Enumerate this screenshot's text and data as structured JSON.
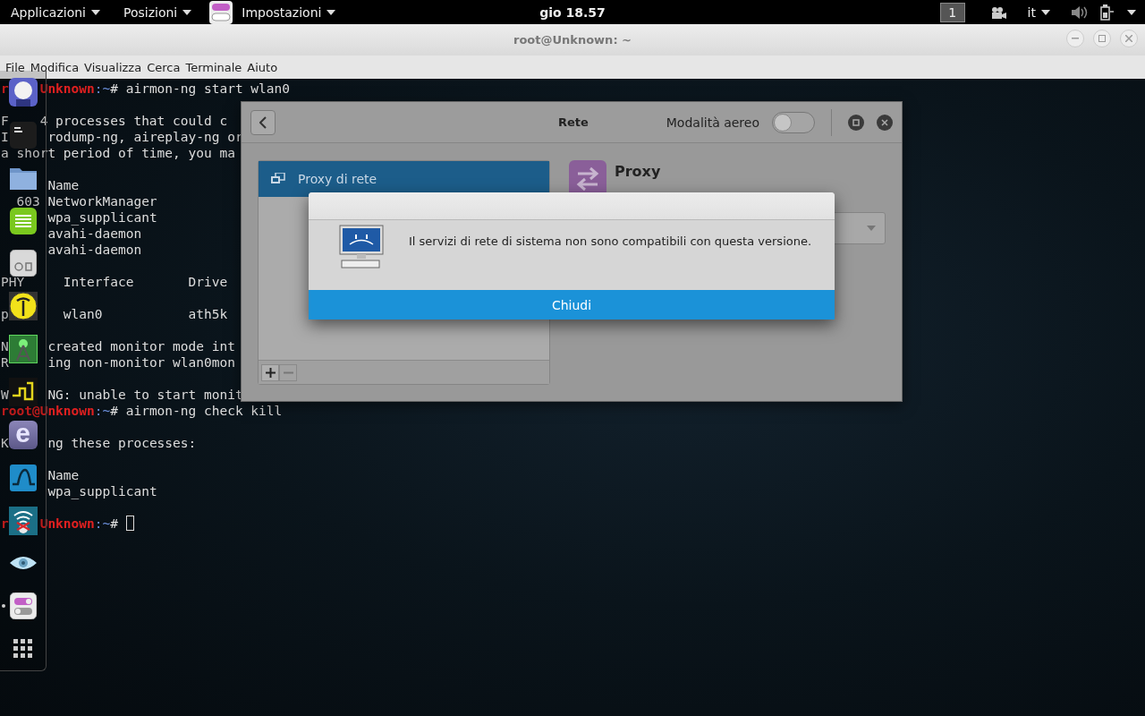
{
  "top_bar": {
    "applications_menu": "Applicazioni",
    "places_menu": "Posizioni",
    "app_menu": "Impostazioni",
    "clock": "gio 18.57",
    "workspace": "1",
    "language": "it"
  },
  "terminal": {
    "title": "root@Unknown: ~",
    "menu": [
      "File",
      "Modifica",
      "Visualizza",
      "Cerca",
      "Terminale",
      "Aiuto"
    ],
    "lines": [
      {
        "kind": "text",
        "segments": [
          {
            "kind": "user",
            "text": "r"
          },
          {
            "kind": "user",
            "text": "    Unknown"
          },
          {
            "kind": "path",
            "text": ":~"
          },
          {
            "kind": "plain",
            "text": "# airmon-ng start wlan0"
          }
        ]
      },
      {
        "kind": "blank"
      },
      {
        "kind": "text",
        "segments": [
          {
            "kind": "plain",
            "text": "F"
          },
          {
            "kind": "plain",
            "text": "    4 processes that could c"
          }
        ]
      },
      {
        "kind": "text",
        "segments": [
          {
            "kind": "plain",
            "text": "I"
          },
          {
            "kind": "plain",
            "text": "     rodump-ng, aireplay-ng or"
          }
        ]
      },
      {
        "kind": "text",
        "segments": [
          {
            "kind": "plain",
            "text": "a short period of time, you ma"
          }
        ]
      },
      {
        "kind": "blank"
      },
      {
        "kind": "text",
        "segments": [
          {
            "kind": "plain",
            "text": "      Name"
          }
        ]
      },
      {
        "kind": "text",
        "segments": [
          {
            "kind": "plain",
            "text": "  603 NetworkManager"
          }
        ]
      },
      {
        "kind": "text",
        "segments": [
          {
            "kind": "plain",
            "text": "      wpa_supplicant"
          }
        ]
      },
      {
        "kind": "text",
        "segments": [
          {
            "kind": "plain",
            "text": "      avahi-daemon"
          }
        ]
      },
      {
        "kind": "text",
        "segments": [
          {
            "kind": "plain",
            "text": "      avahi-daemon"
          }
        ]
      },
      {
        "kind": "blank"
      },
      {
        "kind": "text",
        "segments": [
          {
            "kind": "plain",
            "text": "PHY     Interface       Drive"
          }
        ]
      },
      {
        "kind": "blank"
      },
      {
        "kind": "text",
        "segments": [
          {
            "kind": "plain",
            "text": "p"
          },
          {
            "kind": "plain",
            "text": "       wlan0           ath5k"
          }
        ]
      },
      {
        "kind": "blank"
      },
      {
        "kind": "text",
        "segments": [
          {
            "kind": "plain",
            "text": "N"
          },
          {
            "kind": "plain",
            "text": "     created monitor mode int"
          }
        ]
      },
      {
        "kind": "text",
        "segments": [
          {
            "kind": "plain",
            "text": "R"
          },
          {
            "kind": "plain",
            "text": "     ing non-monitor wlan0mon"
          }
        ]
      },
      {
        "kind": "blank"
      },
      {
        "kind": "text",
        "segments": [
          {
            "kind": "plain",
            "text": "W"
          },
          {
            "kind": "plain",
            "text": "     NG: unable to start monit"
          }
        ]
      },
      {
        "kind": "text",
        "segments": [
          {
            "kind": "user",
            "text": "root@Unknown"
          },
          {
            "kind": "path",
            "text": ":~"
          },
          {
            "kind": "plain",
            "text": "# airmon-ng check kill"
          }
        ]
      },
      {
        "kind": "blank"
      },
      {
        "kind": "text",
        "segments": [
          {
            "kind": "plain",
            "text": "K"
          },
          {
            "kind": "plain",
            "text": "     ng these processes:"
          }
        ]
      },
      {
        "kind": "blank"
      },
      {
        "kind": "text",
        "segments": [
          {
            "kind": "plain",
            "text": "      Name"
          }
        ]
      },
      {
        "kind": "text",
        "segments": [
          {
            "kind": "plain",
            "text": "      wpa_supplicant"
          }
        ]
      },
      {
        "kind": "blank"
      },
      {
        "kind": "text",
        "segments": [
          {
            "kind": "user",
            "text": "r"
          },
          {
            "kind": "user",
            "text": "    Unknown"
          },
          {
            "kind": "path",
            "text": ":~"
          },
          {
            "kind": "plain",
            "text": "# "
          },
          {
            "kind": "cursor"
          }
        ]
      }
    ]
  },
  "dock": {
    "items": [
      {
        "kind": "head",
        "running": false
      },
      {
        "kind": "terminal",
        "running": false
      },
      {
        "kind": "folder",
        "running": false
      },
      {
        "kind": "notes",
        "running": false
      },
      {
        "kind": "device",
        "running": false
      },
      {
        "kind": "antenna",
        "running": false
      },
      {
        "kind": "tower",
        "running": false
      },
      {
        "kind": "squiggle",
        "running": false
      },
      {
        "kind": "letter",
        "label": "e",
        "running": false
      },
      {
        "kind": "fin",
        "running": false
      },
      {
        "kind": "wifi",
        "running": false
      },
      {
        "kind": "eye",
        "running": false
      },
      {
        "kind": "toggle",
        "running": true
      },
      {
        "kind": "grid",
        "running": false
      }
    ]
  },
  "settings_window": {
    "title": "Rete",
    "airplane_mode": {
      "label": "Modalità aereo",
      "on": false
    },
    "devices": [
      {
        "label": "Proxy di rete",
        "selected": true
      }
    ],
    "panel_title": "Proxy"
  },
  "dialog": {
    "message": "Il servizi di rete di sistema non sono compatibili con questa versione.",
    "button": "Chiudi"
  }
}
